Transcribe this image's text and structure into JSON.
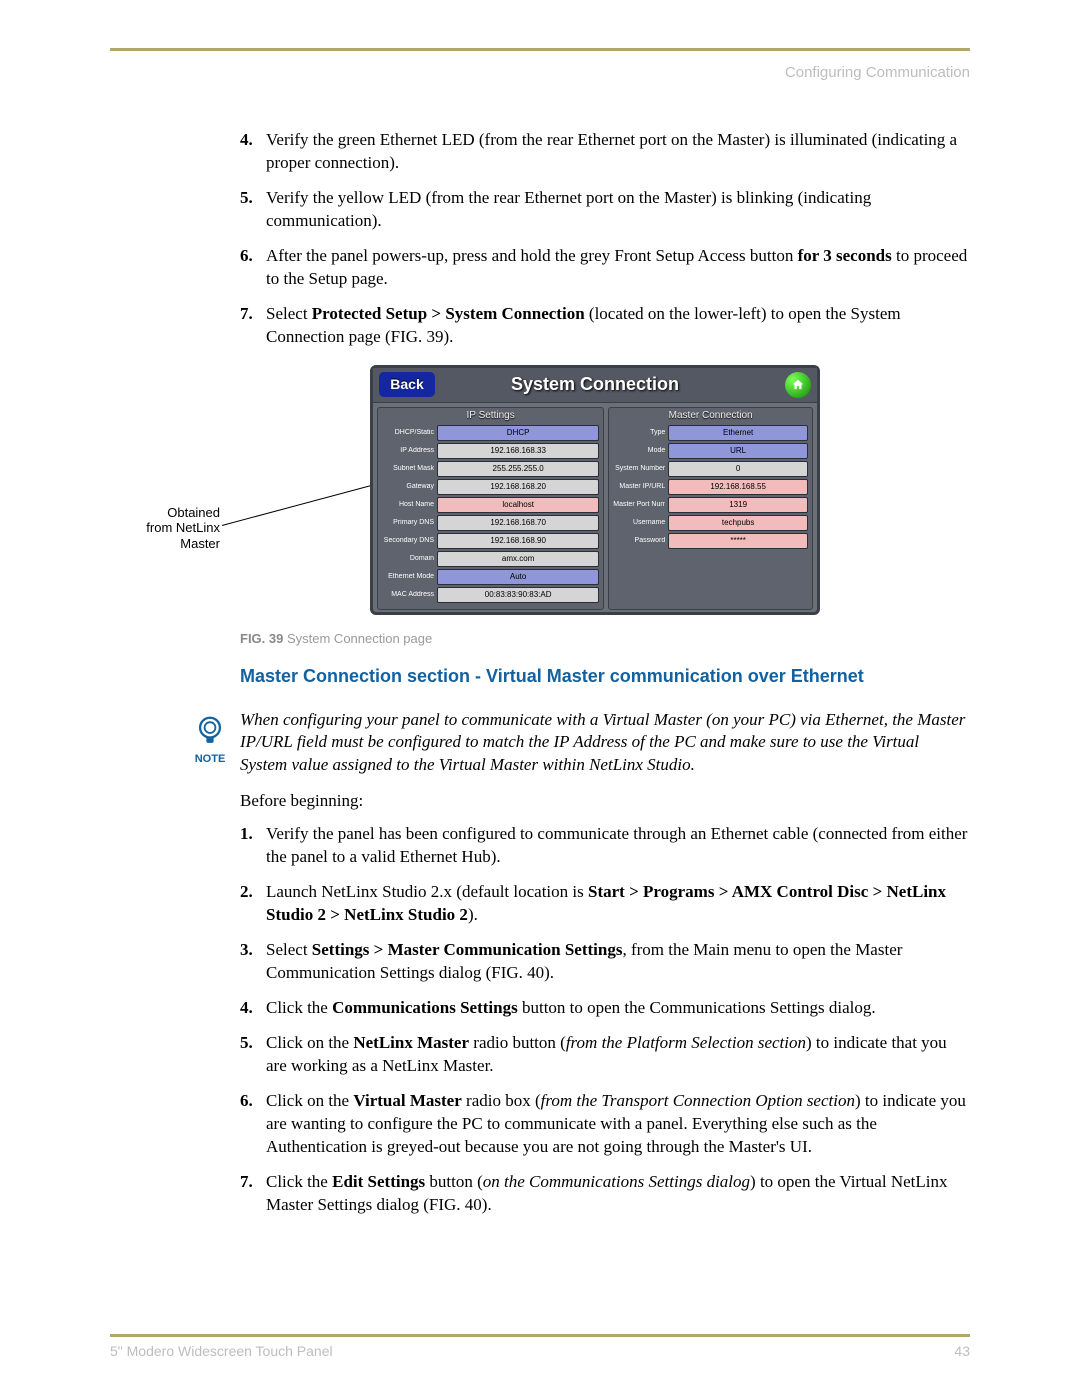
{
  "header": {
    "section": "Configuring Communication"
  },
  "list1": [
    {
      "num": "4.",
      "text": "Verify the green Ethernet LED (from the rear Ethernet port on the Master) is illuminated (indicating a proper connection)."
    },
    {
      "num": "5.",
      "text": "Verify the yellow LED (from the rear Ethernet port on the Master) is blinking (indicating communication)."
    },
    {
      "num": "6.",
      "pre": "After the panel powers-up, press and hold the grey Front Setup Access button ",
      "bold": "for 3 seconds",
      "post": " to proceed to the Setup page."
    },
    {
      "num": "7.",
      "pre": "Select ",
      "bold": "Protected Setup > System Connection",
      "post": " (located on the lower-left) to open the System Connection page (FIG. 39)."
    }
  ],
  "callout": "Obtained from NetLinx Master",
  "panel": {
    "back": "Back",
    "title": "System Connection",
    "ip_heading": "IP Settings",
    "mc_heading": "Master Connection",
    "ip_rows": [
      {
        "label": "DHCP/Static",
        "value": "DHCP",
        "cls": "blue"
      },
      {
        "label": "IP Address",
        "value": "192.168.168.33",
        "cls": "gray"
      },
      {
        "label": "Subnet Mask",
        "value": "255.255.255.0",
        "cls": "gray"
      },
      {
        "label": "Gateway",
        "value": "192.168.168.20",
        "cls": "gray"
      },
      {
        "label": "Host Name",
        "value": "localhost",
        "cls": "pink"
      },
      {
        "label": "Primary DNS",
        "value": "192.168.168.70",
        "cls": "gray"
      },
      {
        "label": "Secondary DNS",
        "value": "192.168.168.90",
        "cls": "gray"
      },
      {
        "label": "Domain",
        "value": "amx.com",
        "cls": "gray"
      },
      {
        "label": "Ethernet Mode",
        "value": "Auto",
        "cls": "blue"
      },
      {
        "label": "MAC Address",
        "value": "00:83:83:90:83:AD",
        "cls": "gray"
      }
    ],
    "mc_rows": [
      {
        "label": "Type",
        "value": "Ethernet",
        "cls": "blue"
      },
      {
        "label": "Mode",
        "value": "URL",
        "cls": "blue"
      },
      {
        "label": "System Number",
        "value": "0",
        "cls": "gray"
      },
      {
        "label": "Master IP/URL",
        "value": "192.168.168.55",
        "cls": "pink"
      },
      {
        "label": "Master Port Number",
        "value": "1319",
        "cls": "pink"
      },
      {
        "label": "Username",
        "value": "techpubs",
        "cls": "pink"
      },
      {
        "label": "Password",
        "value": "*****",
        "cls": "pink"
      }
    ]
  },
  "figcaption": {
    "fignum": "FIG. 39",
    "text": " System Connection page"
  },
  "section_title": "Master Connection section - Virtual Master communication over Ethernet",
  "note": {
    "label": "NOTE",
    "text": "When configuring your panel to communicate with a Virtual Master (on your PC) via Ethernet, the Master IP/URL field must be configured to match the IP Address of the PC and make sure to use the Virtual System value assigned to the Virtual Master within NetLinx Studio."
  },
  "before": "Before beginning:",
  "list2": [
    {
      "num": "1.",
      "html": "Verify the panel has been configured to communicate through an Ethernet cable (connected from either the panel to a valid Ethernet Hub)."
    },
    {
      "num": "2.",
      "html": "Launch NetLinx Studio 2.x (default location is <b>Start > Programs > AMX Control Disc > NetLinx Studio 2 > NetLinx Studio 2</b>)."
    },
    {
      "num": "3.",
      "html": "Select <b>Settings > Master Communication Settings</b>, from the Main menu to open the Master Communication Settings dialog (FIG. 40)."
    },
    {
      "num": "4.",
      "html": "Click the <b>Communications Settings</b> button to open the Communications Settings dialog."
    },
    {
      "num": "5.",
      "html": "Click on the <b>NetLinx Master</b> radio button (<i>from the Platform Selection section</i>) to indicate that you are working as a NetLinx Master."
    },
    {
      "num": "6.",
      "html": "Click on the <b>Virtual Master</b> radio box (<i>from the Transport Connection Option section</i>) to indicate you are wanting to configure the PC to communicate with a panel. Everything else such as the Authentication is greyed-out because you are not going through the Master's UI."
    },
    {
      "num": "7.",
      "html": "Click the <b>Edit Settings</b> button (<i>on the Communications Settings dialog</i>) to open the Virtual NetLinx Master Settings dialog (FIG. 40)."
    }
  ],
  "footer": {
    "product": "5\" Modero Widescreen Touch Panel",
    "page": "43"
  }
}
